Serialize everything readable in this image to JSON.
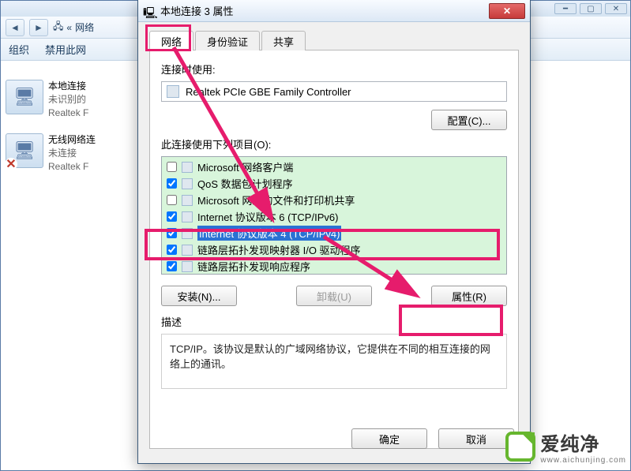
{
  "explorer": {
    "crumb": "网络",
    "crumb_prefix": "«",
    "tool_org": "组织",
    "tool_disable": "禁用此网"
  },
  "connections": [
    {
      "name": "本地连接",
      "status": "未识别的",
      "device": "Realtek F",
      "x": false
    },
    {
      "name": "无线网络连",
      "status": "未连接",
      "device": "Realtek F",
      "x": true
    }
  ],
  "dialog": {
    "title": "本地连接 3 属性",
    "tabs": {
      "network": "网络",
      "auth": "身份验证",
      "share": "共享"
    },
    "labels": {
      "connect_using": "连接时使用:",
      "adapter": "Realtek PCIe GBE Family Controller",
      "configure_btn": "配置(C)...",
      "items_label": "此连接使用下列项目(O):",
      "install_btn": "安装(N)...",
      "uninstall_btn": "卸载(U)",
      "properties_btn": "属性(R)",
      "desc_label": "描述",
      "desc_text": "TCP/IP。该协议是默认的广域网络协议，它提供在不同的相互连接的网络上的通讯。",
      "ok_btn": "确定",
      "cancel_btn": "取消"
    },
    "items": [
      {
        "checked": false,
        "label": "Microsoft 网络客户端"
      },
      {
        "checked": true,
        "label": "QoS 数据包计划程序"
      },
      {
        "checked": false,
        "label": "Microsoft 网络的文件和打印机共享"
      },
      {
        "checked": true,
        "label": "Internet 协议版本 6 (TCP/IPv6)"
      },
      {
        "checked": true,
        "label": "Internet 协议版本 4 (TCP/IPv4)",
        "selected": true
      },
      {
        "checked": true,
        "label": "链路层拓扑发现映射器 I/O 驱动程序"
      },
      {
        "checked": true,
        "label": "链路层拓扑发现响应程序"
      }
    ]
  },
  "logo": {
    "text": "爱纯净",
    "sub": "www.aichunjing.com"
  },
  "highlight_color": "#e61c6c"
}
